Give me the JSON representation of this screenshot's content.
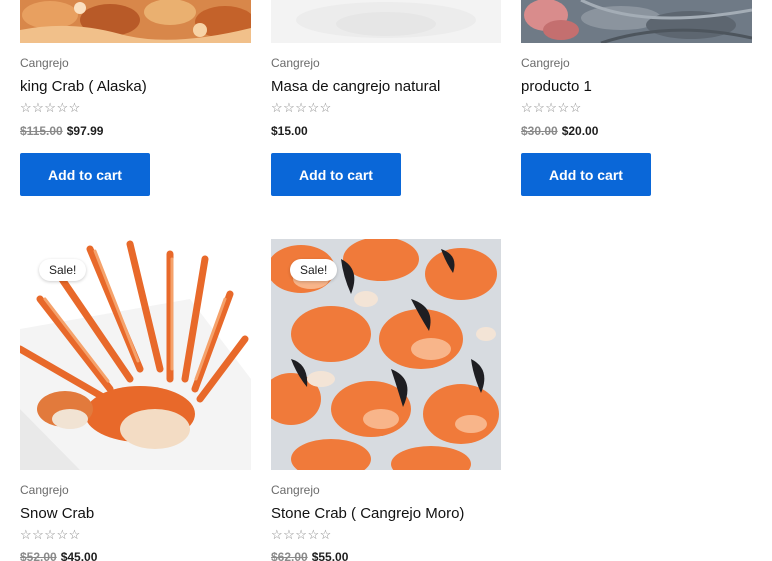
{
  "products": [
    {
      "category": "Cangrejo",
      "title": "king Crab ( Alaska)",
      "stars": "☆☆☆☆☆",
      "old_price": "$115.00",
      "price": "$97.99",
      "button": "Add to cart"
    },
    {
      "category": "Cangrejo",
      "title": "Masa de cangrejo natural",
      "stars": "☆☆☆☆☆",
      "price": "$15.00",
      "button": "Add to cart"
    },
    {
      "category": "Cangrejo",
      "title": "producto 1",
      "stars": "☆☆☆☆☆",
      "old_price": "$30.00",
      "price": "$20.00",
      "button": "Add to cart"
    },
    {
      "badge": "Sale!",
      "category": "Cangrejo",
      "title": "Snow Crab",
      "stars": "☆☆☆☆☆",
      "old_price": "$52.00",
      "price": "$45.00"
    },
    {
      "badge": "Sale!",
      "category": "Cangrejo",
      "title": "Stone Crab ( Cangrejo Moro)",
      "stars": "☆☆☆☆☆",
      "old_price": "$62.00",
      "price": "$55.00"
    }
  ],
  "colors": {
    "button": "#0a67d8",
    "crab_orange": "#e8692a"
  }
}
